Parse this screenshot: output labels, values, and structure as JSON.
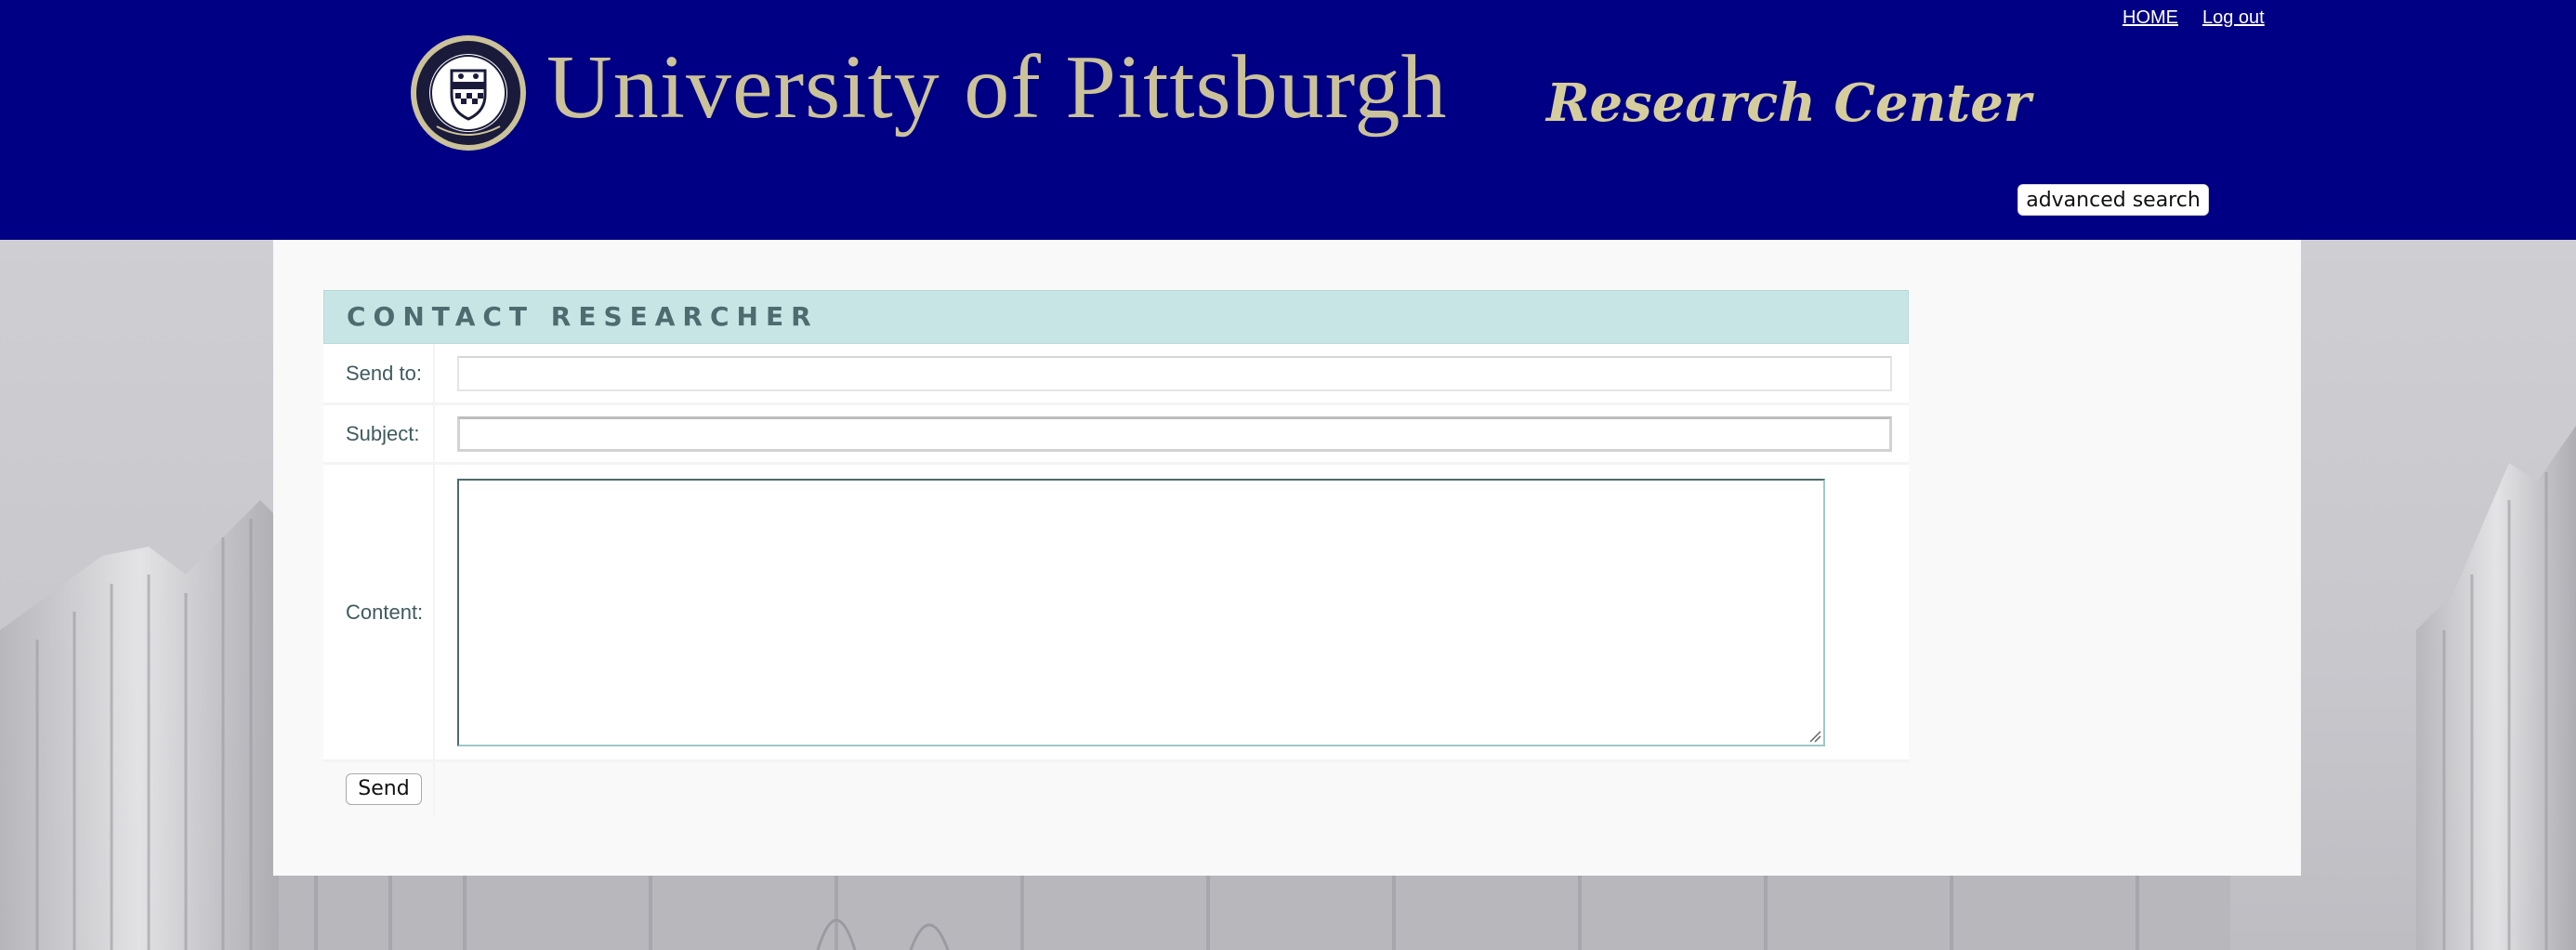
{
  "header": {
    "university_name": "University of Pittsburgh",
    "center_name": "Research Center",
    "links": {
      "home": "HOME",
      "logout": "Log out"
    },
    "advanced_search_label": "advanced search",
    "seal_text": "UNIVERSITY OF PITTSBURGH",
    "colors": {
      "background": "#000084",
      "gold": "#cbc29a"
    }
  },
  "form": {
    "title": "CONTACT RESEARCHER",
    "fields": {
      "send_to_label": "Send to:",
      "send_to_value": "",
      "subject_label": "Subject:",
      "subject_value": "",
      "content_label": "Content:",
      "content_value": ""
    },
    "send_label": "Send",
    "colors": {
      "header_bg": "#c8e5e6",
      "label_text": "#3f5a5e"
    }
  }
}
